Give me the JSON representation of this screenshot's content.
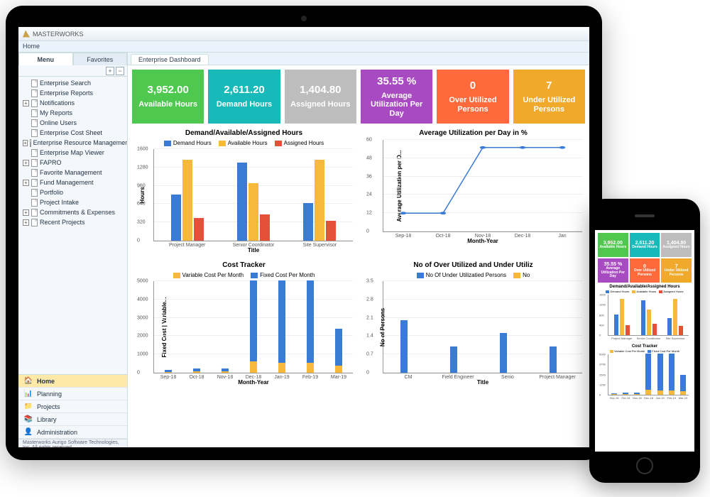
{
  "brand": "MASTERWORKS",
  "breadcrumb": "Home",
  "sidebar": {
    "tabs": {
      "menu": "Menu",
      "favorites": "Favorites"
    },
    "items": [
      {
        "label": "Enterprise Search",
        "expandable": false,
        "indent": 1
      },
      {
        "label": "Enterprise Reports",
        "expandable": false,
        "indent": 1
      },
      {
        "label": "Notifications",
        "expandable": true,
        "indent": 0
      },
      {
        "label": "My Reports",
        "expandable": false,
        "indent": 1
      },
      {
        "label": "Online Users",
        "expandable": false,
        "indent": 1
      },
      {
        "label": "Enterprise Cost Sheet",
        "expandable": false,
        "indent": 1
      },
      {
        "label": "Enterprise Resource Managemen",
        "expandable": true,
        "indent": 0
      },
      {
        "label": "Enterprise Map Viewer",
        "expandable": false,
        "indent": 1
      },
      {
        "label": "FAPRO",
        "expandable": true,
        "indent": 0
      },
      {
        "label": "Favorite Management",
        "expandable": false,
        "indent": 1
      },
      {
        "label": "Fund Management",
        "expandable": true,
        "indent": 0
      },
      {
        "label": "Portfolio",
        "expandable": false,
        "indent": 1
      },
      {
        "label": "Project Intake",
        "expandable": false,
        "indent": 1
      },
      {
        "label": "Commitments & Expenses",
        "expandable": true,
        "indent": 0
      },
      {
        "label": "Recent Projects",
        "expandable": true,
        "indent": 0
      }
    ]
  },
  "bottom_nav": [
    {
      "label": "Home",
      "icon": "🏠",
      "active": true
    },
    {
      "label": "Planning",
      "icon": "📊",
      "active": false
    },
    {
      "label": "Projects",
      "icon": "📁",
      "active": false
    },
    {
      "label": "Library",
      "icon": "📚",
      "active": false
    },
    {
      "label": "Administration",
      "icon": "👤",
      "active": false
    }
  ],
  "footer": "Masterworks Aurigo Software Technologies, Inc. All rights reserved.",
  "main_tab": "Enterprise Dashboard",
  "kpis": [
    {
      "value": "3,952.00",
      "label": "Available Hours",
      "color": "c-green"
    },
    {
      "value": "2,611.20",
      "label": "Demand Hours",
      "color": "c-teal"
    },
    {
      "value": "1,404.80",
      "label": "Assigned Hours",
      "color": "c-gray"
    },
    {
      "value": "35.55 %",
      "label": "Average Utilization Per Day",
      "color": "c-purple"
    },
    {
      "value": "0",
      "label": "Over Utilized Persons",
      "color": "c-orange"
    },
    {
      "value": "7",
      "label": "Under Utilized Persons",
      "color": "c-amber"
    }
  ],
  "chart_data": [
    {
      "type": "bar",
      "title": "Demand/Available/Assigned Hours",
      "xlabel": "Title",
      "ylabel": "Hours",
      "ylim": [
        0,
        1600
      ],
      "categories": [
        "Project Manager",
        "Senior Coordinator",
        "Site Supervisor"
      ],
      "series": [
        {
          "name": "Demand Hours",
          "color": "#3a7bd5",
          "values": [
            800,
            1350,
            650
          ]
        },
        {
          "name": "Available Hours",
          "color": "#f6b93b",
          "values": [
            1400,
            1000,
            1400
          ]
        },
        {
          "name": "Assigned Hours",
          "color": "#e55039",
          "values": [
            400,
            450,
            350
          ]
        }
      ]
    },
    {
      "type": "line",
      "title": "Average Utilization per Day in %",
      "xlabel": "Month-Year",
      "ylabel": "Average Utilization per D...",
      "ylim": [
        0,
        60
      ],
      "categories": [
        "Sep-18",
        "Oct-18",
        "Nov-18",
        "Dec-18",
        "Jan"
      ],
      "series": [
        {
          "name": "Utilization",
          "color": "#3a7bd5",
          "values": [
            12,
            12,
            55,
            55,
            55
          ]
        }
      ]
    },
    {
      "type": "bar",
      "stacked": true,
      "title": "Cost Tracker",
      "xlabel": "Month-Year",
      "ylabel": "Fixed Cost | Variable...",
      "ylim": [
        0,
        5000
      ],
      "categories": [
        "Sep-18",
        "Oct-18",
        "Nov-18",
        "Dec-18",
        "Jan-19",
        "Feb-19",
        "Mar-19"
      ],
      "series": [
        {
          "name": "Variable Cost Per Month",
          "color": "#f6b93b",
          "values": [
            50,
            80,
            80,
            600,
            550,
            550,
            400
          ]
        },
        {
          "name": "Fixed Cost Per Month",
          "color": "#3a7bd5",
          "values": [
            100,
            150,
            150,
            4400,
            4450,
            4450,
            2000
          ]
        }
      ]
    },
    {
      "type": "bar",
      "title": "No of Over Utilized and Under Utiliz",
      "xlabel": "Title",
      "ylabel": "No of Persons",
      "ylim": [
        0,
        3.5
      ],
      "categories": [
        "CM",
        "Field Engineer",
        "Senio",
        "Project Manager"
      ],
      "series": [
        {
          "name": "No Of Under Utilizatied Persons",
          "color": "#3a7bd5",
          "values": [
            2,
            1,
            1.5,
            1
          ]
        },
        {
          "name": "No",
          "color": "#f6b93b",
          "values": [
            0,
            0,
            0,
            0
          ]
        }
      ]
    }
  ]
}
